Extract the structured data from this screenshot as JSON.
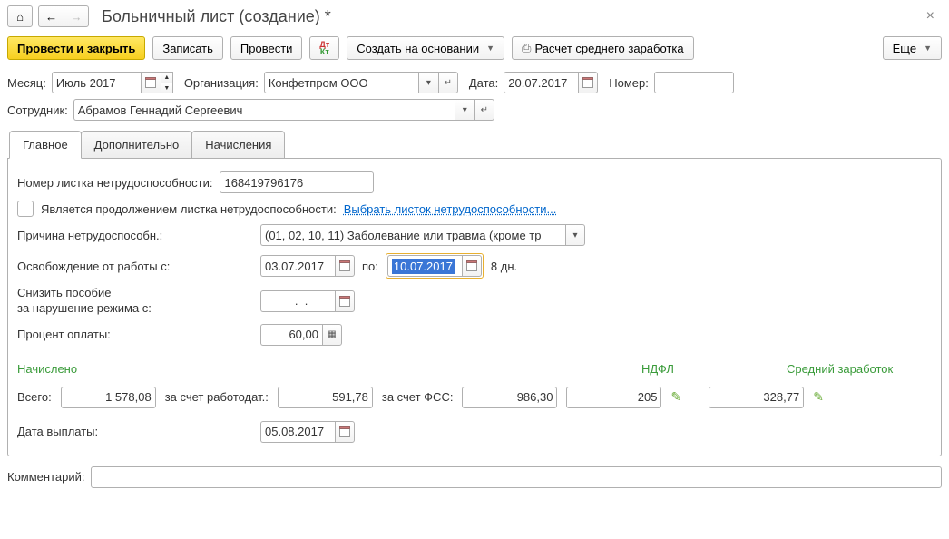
{
  "title": "Больничный лист (создание) *",
  "toolbar": {
    "submit": "Провести и закрыть",
    "save": "Записать",
    "post": "Провести",
    "create_based": "Создать на основании",
    "avg_calc": "Расчет среднего заработка",
    "more": "Еще"
  },
  "header": {
    "month_label": "Месяц:",
    "month_value": "Июль 2017",
    "org_label": "Организация:",
    "org_value": "Конфетпром ООО",
    "date_label": "Дата:",
    "date_value": "20.07.2017",
    "number_label": "Номер:",
    "number_value": "",
    "employee_label": "Сотрудник:",
    "employee_value": "Абрамов Геннадий Сергеевич"
  },
  "tabs": {
    "main": "Главное",
    "extra": "Дополнительно",
    "accruals": "Начисления"
  },
  "main_tab": {
    "sheet_no_label": "Номер листка нетрудоспособности:",
    "sheet_no_value": "168419796176",
    "continuation_label": "Является продолжением листка нетрудоспособности:",
    "select_sheet_link": "Выбрать листок нетрудоспособности...",
    "reason_label": "Причина нетрудоспособн.:",
    "reason_value": "(01, 02, 10, 11) Заболевание или травма (кроме тр",
    "leave_from_label": "Освобождение от работы с:",
    "leave_from_value": "03.07.2017",
    "leave_to_label": "по:",
    "leave_to_value": "10.07.2017",
    "days_text": "8 дн.",
    "reduce_label": "Снизить пособие\nза нарушение режима с:",
    "reduce_value": "  .  .",
    "percent_label": "Процент оплаты:",
    "percent_value": "60,00",
    "accrued_header": "Начислено",
    "ndfl_header": "НДФЛ",
    "avg_header": "Средний заработок",
    "total_label": "Всего:",
    "total_value": "1 578,08",
    "employer_label": "за счет работодат.:",
    "employer_value": "591,78",
    "fss_label": "за счет ФСС:",
    "fss_value": "986,30",
    "ndfl_value": "205",
    "avg_value": "328,77",
    "payment_date_label": "Дата выплаты:",
    "payment_date_value": "05.08.2017"
  },
  "footer": {
    "comment_label": "Комментарий:",
    "comment_value": ""
  }
}
